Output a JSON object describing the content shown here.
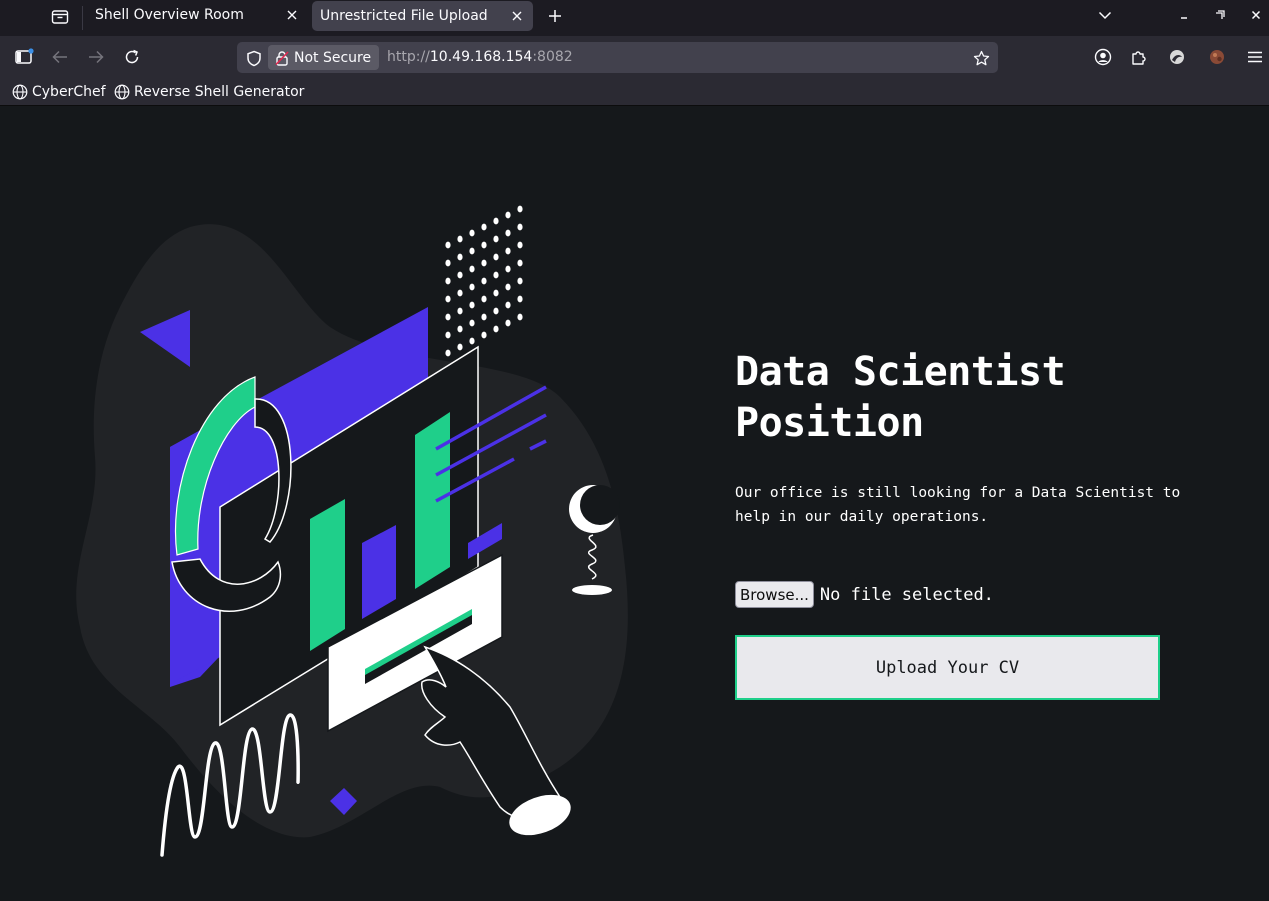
{
  "browser": {
    "tabs": [
      {
        "title": "Shell Overview Room",
        "active": false
      },
      {
        "title": "Unrestricted File Upload",
        "active": true
      }
    ],
    "address": {
      "security_label": "Not Secure",
      "url_scheme": "http://",
      "url_host": "10.49.168.154",
      "url_port": ":8082"
    },
    "bookmarks": [
      {
        "label": "CyberChef",
        "icon": "globe-icon"
      },
      {
        "label": "Reverse Shell Generator",
        "icon": "globe-icon"
      }
    ],
    "icons": {
      "tab_list": "tab-list-icon",
      "close": "close-icon",
      "new_tab": "plus-icon",
      "list_all_tabs": "chevron-down-icon",
      "minimize": "minimize-icon",
      "restore": "restore-icon",
      "window_close": "close-icon",
      "sidebar": "sidebar-icon",
      "back": "back-arrow-icon",
      "forward": "forward-arrow-icon",
      "reload": "reload-icon",
      "shield": "shield-icon",
      "lock": "lock-warning-icon",
      "bookmark": "star-icon",
      "account": "account-icon",
      "extensions": "puzzle-icon",
      "extension_1": "extension-icon",
      "extension_2": "extension-avatar-icon",
      "menu": "hamburger-menu-icon"
    }
  },
  "page": {
    "title_line1": "Data Scientist",
    "title_line2": "Position",
    "description": "Our office is still looking for a Data Scientist to help in our daily operations.",
    "browse_label": "Browse...",
    "no_file_label": "No file selected.",
    "upload_label": "Upload Your CV"
  },
  "colors": {
    "page_bg": "#15181b",
    "accent_green": "#1fcf8a",
    "accent_purple": "#4b31e6",
    "blob": "#212326"
  }
}
